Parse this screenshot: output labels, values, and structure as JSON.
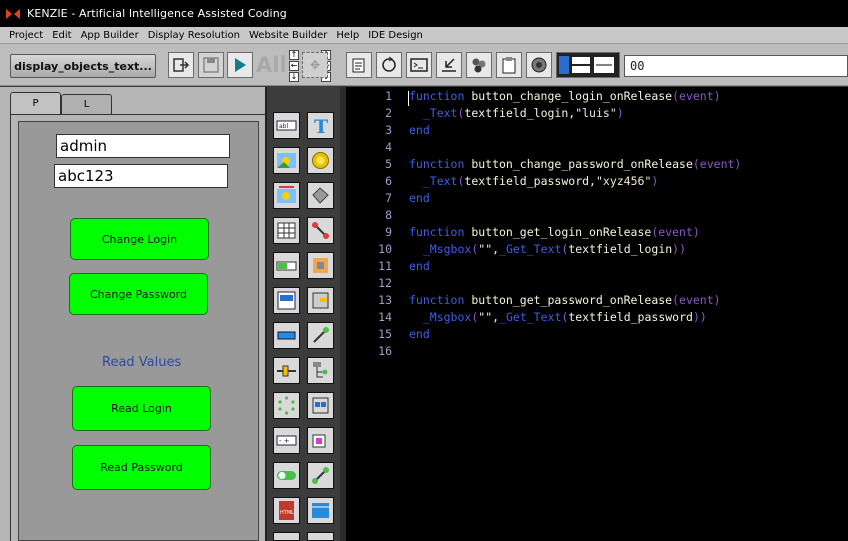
{
  "window": {
    "title": "KENZIE - Artificial Intelligence Assisted Coding"
  },
  "menu": [
    "Project",
    "Edit",
    "App Builder",
    "Display Resolution",
    "Website Builder",
    "Help",
    "IDE Design"
  ],
  "toolbar": {
    "file_button": "display_objects_text...",
    "all_label": "All",
    "value_field": "00",
    "icons": [
      "exit-icon",
      "save-icon",
      "run-icon",
      "nudge-arrows-icon",
      "move-icon",
      "properties-icon",
      "refresh-icon",
      "console-icon",
      "import-icon",
      "components-icon",
      "clipboard-icon",
      "speaker-icon",
      "layout-tools-icon"
    ]
  },
  "tabs": [
    "P",
    "L"
  ],
  "design": {
    "fields": [
      "admin",
      "abc123"
    ],
    "buttons": [
      "Change Login",
      "Change Password",
      "Read Login",
      "Read Password"
    ],
    "label": "Read Values"
  },
  "palette": {
    "icons": [
      "textfield-icon",
      "text-icon",
      "image-icon",
      "coin-button-icon",
      "animated-image-icon",
      "shape-icon",
      "table-icon",
      "connector-icon",
      "progress-icon",
      "layout-icon",
      "input-box-icon",
      "dock-icon",
      "button-icon",
      "link-icon",
      "slider-icon",
      "tree-icon",
      "spinner-icon",
      "group-icon",
      "stepper-icon",
      "resize-icon",
      "toggle-icon",
      "path-icon",
      "html-icon",
      "web-icon"
    ]
  },
  "editor": {
    "lines": [
      {
        "n": "1",
        "tokens": [
          [
            "kw",
            "function "
          ],
          [
            "pl",
            "button_change_login_onRelease"
          ],
          [
            "pr",
            "(event)"
          ]
        ]
      },
      {
        "n": "2",
        "tokens": [
          [
            "pl",
            "  "
          ],
          [
            "fn",
            "_Text"
          ],
          [
            "pr",
            "("
          ],
          [
            "pl",
            "textfield_login,"
          ],
          [
            "st",
            "\"luis\""
          ],
          [
            "pr",
            ")"
          ]
        ]
      },
      {
        "n": "3",
        "tokens": [
          [
            "kw",
            "end"
          ]
        ]
      },
      {
        "n": "4",
        "tokens": []
      },
      {
        "n": "5",
        "tokens": [
          [
            "kw",
            "function "
          ],
          [
            "pl",
            "button_change_password_onRelease"
          ],
          [
            "pr",
            "(event)"
          ]
        ]
      },
      {
        "n": "6",
        "tokens": [
          [
            "pl",
            "  "
          ],
          [
            "fn",
            "_Text"
          ],
          [
            "pr",
            "("
          ],
          [
            "pl",
            "textfield_password,"
          ],
          [
            "st",
            "\"xyz456\""
          ],
          [
            "pr",
            ")"
          ]
        ]
      },
      {
        "n": "7",
        "tokens": [
          [
            "kw",
            "end"
          ]
        ]
      },
      {
        "n": "8",
        "tokens": []
      },
      {
        "n": "9",
        "tokens": [
          [
            "kw",
            "function "
          ],
          [
            "pl",
            "button_get_login_onRelease"
          ],
          [
            "pr",
            "(event)"
          ]
        ]
      },
      {
        "n": "10",
        "tokens": [
          [
            "pl",
            "  "
          ],
          [
            "fn",
            "_Msgbox"
          ],
          [
            "pr",
            "("
          ],
          [
            "st",
            "\"\""
          ],
          [
            "pl",
            ","
          ],
          [
            "fn",
            "_Get_Text"
          ],
          [
            "pr",
            "("
          ],
          [
            "pl",
            "textfield_login"
          ],
          [
            "pr",
            "))"
          ]
        ]
      },
      {
        "n": "11",
        "tokens": [
          [
            "kw",
            "end"
          ]
        ]
      },
      {
        "n": "12",
        "tokens": []
      },
      {
        "n": "13",
        "tokens": [
          [
            "kw",
            "function "
          ],
          [
            "pl",
            "button_get_password_onRelease"
          ],
          [
            "pr",
            "(event)"
          ]
        ]
      },
      {
        "n": "14",
        "tokens": [
          [
            "pl",
            "  "
          ],
          [
            "fn",
            "_Msgbox"
          ],
          [
            "pr",
            "("
          ],
          [
            "st",
            "\"\""
          ],
          [
            "pl",
            ","
          ],
          [
            "fn",
            "_Get_Text"
          ],
          [
            "pr",
            "("
          ],
          [
            "pl",
            "textfield_password"
          ],
          [
            "pr",
            "))"
          ]
        ]
      },
      {
        "n": "15",
        "tokens": [
          [
            "kw",
            "end"
          ]
        ]
      },
      {
        "n": "16",
        "tokens": []
      }
    ]
  }
}
